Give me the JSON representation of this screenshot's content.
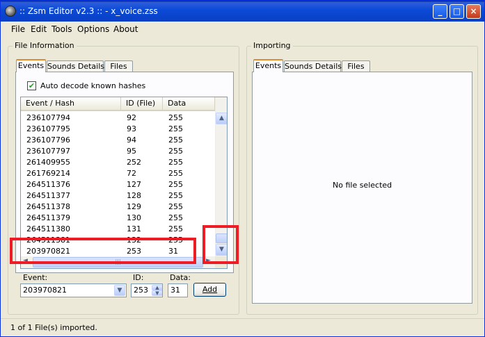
{
  "window": {
    "title": ":: Zsm Editor v2.3 :: - x_voice.zss",
    "minimize": "_",
    "maximize": "□",
    "close": "×"
  },
  "menu": [
    "File",
    "Edit",
    "Tools",
    "Options",
    "About"
  ],
  "file_info": {
    "group_label": "File Information",
    "tabs": [
      "Events",
      "Sounds Details",
      "Files"
    ],
    "active_tab": "Events",
    "auto_decode": {
      "label": "Auto decode known hashes",
      "checked": true,
      "check_glyph": "✔"
    },
    "list": {
      "columns": [
        "Event / Hash",
        "ID (File)",
        "Data"
      ],
      "rows": [
        [
          "236107794",
          "92",
          "255"
        ],
        [
          "236107795",
          "93",
          "255"
        ],
        [
          "236107796",
          "94",
          "255"
        ],
        [
          "236107797",
          "95",
          "255"
        ],
        [
          "261409955",
          "252",
          "255"
        ],
        [
          "261769214",
          "72",
          "255"
        ],
        [
          "264511376",
          "127",
          "255"
        ],
        [
          "264511377",
          "128",
          "255"
        ],
        [
          "264511378",
          "129",
          "255"
        ],
        [
          "264511379",
          "130",
          "255"
        ],
        [
          "264511380",
          "131",
          "255"
        ],
        [
          "264511381",
          "132",
          "255"
        ],
        [
          "203970821",
          "253",
          "31"
        ]
      ]
    },
    "scroll": {
      "up_icon": "▲",
      "down_icon": "▼",
      "left_icon": "◄",
      "right_icon": "►",
      "grip": "|||"
    },
    "event_label": "Event:",
    "event_value": "203970821",
    "id_label": "ID:",
    "id_value": "253",
    "data_label": "Data:",
    "data_value": "31",
    "add_button": "Add"
  },
  "importing": {
    "group_label": "Importing",
    "tabs": [
      "Events",
      "Sounds Details",
      "Files"
    ],
    "active_tab": "Events",
    "empty_text": "No file selected"
  },
  "status": {
    "text": "1 of 1 File(s) imported."
  },
  "colors": {
    "accent": "#e68b2c",
    "highlight": "#ee1c24",
    "titlebar": "#0b4ad6"
  }
}
